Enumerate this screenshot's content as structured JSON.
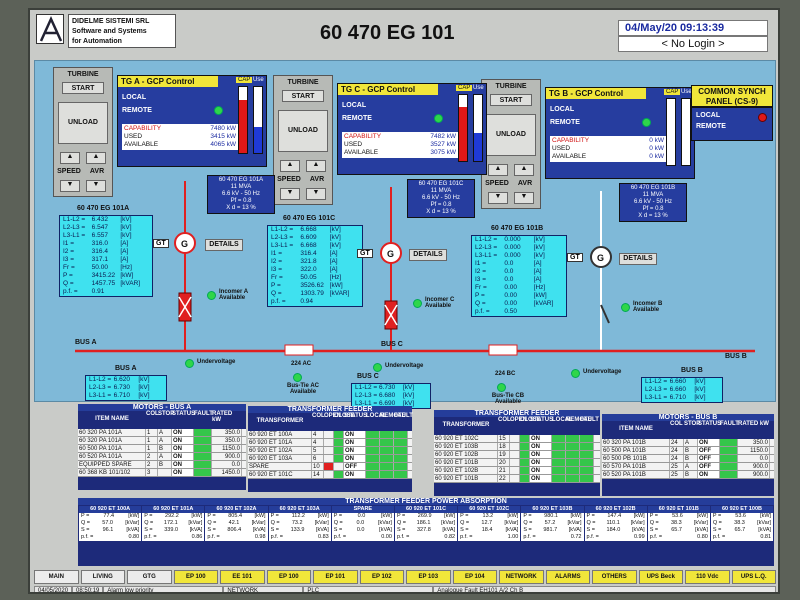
{
  "header": {
    "company_line1": "DIDELME SISTEMI SRL",
    "company_line2": "Software and Systems",
    "company_line3": "for Automation",
    "title": "60 470 EG 101",
    "datetime": "04/May/20 09:13:39",
    "login": "< No Login >"
  },
  "controls": {
    "turbine": "TURBINE",
    "start": "START",
    "unload": "UNLOAD",
    "speed": "SPEED",
    "avr": "AVR"
  },
  "gcp": [
    {
      "title": "TG A - GCP Control",
      "local": "LOCAL",
      "remote": "REMOTE",
      "cap": "CAP",
      "use": "Use",
      "capability_label": "CAPABILITY",
      "capability": "7480 kW",
      "used_label": "USED",
      "used": "3415 kW",
      "available_label": "AVAILABLE",
      "available": "4065 kW",
      "cap_level": 0.8,
      "use_level": 0.4
    },
    {
      "title": "TG C - GCP Control",
      "local": "LOCAL",
      "remote": "REMOTE",
      "cap": "CAP",
      "use": "Use",
      "capability_label": "CAPABILITY",
      "capability": "7482 kW",
      "used_label": "USED",
      "used": "3527 kW",
      "available_label": "AVAILABLE",
      "available": "3075 kW",
      "cap_level": 0.82,
      "use_level": 0.42
    },
    {
      "title": "TG B - GCP Control",
      "local": "LOCAL",
      "remote": "REMOTE",
      "cap": "CAP",
      "use": "Use",
      "capability_label": "CAPABILITY",
      "capability": "0 kW",
      "used_label": "USED",
      "used": "0 kW",
      "available_label": "AVAILABLE",
      "available": "0 kW",
      "cap_level": 0,
      "use_level": 0
    }
  ],
  "sync": {
    "title": "COMMON SYNCH PANEL (CS-9)",
    "local": "LOCAL",
    "remote": "REMOTE"
  },
  "gen_labels": [
    {
      "l1": "60 470 EG 101A",
      "l2": "11 MVA",
      "l3": "6.6 kV - 50 Hz",
      "l4": "Pf = 0.8",
      "l5": "X d = 13 %"
    },
    {
      "l1": "60 470 EG 101C",
      "l2": "11 MVA",
      "l3": "6.6 kV - 50 Hz",
      "l4": "Pf = 0.8",
      "l5": "X d = 13 %"
    },
    {
      "l1": "60 470 EG 101B",
      "l2": "11 MVA",
      "l3": "6.6 kV - 50 Hz",
      "l4": "Pf = 0.8",
      "l5": "X d = 13 %"
    }
  ],
  "meters": [
    {
      "title": "60 470 EG 101A",
      "rows": [
        [
          "L1-L2 =",
          "6.432",
          "[kV]"
        ],
        [
          "L2-L3 =",
          "6.547",
          "[kV]"
        ],
        [
          "L3-L1 =",
          "6.557",
          "[kV]"
        ],
        [
          "I1 =",
          "316.0",
          "[A]"
        ],
        [
          "I2 =",
          "316.4",
          "[A]"
        ],
        [
          "I3 =",
          "317.1",
          "[A]"
        ],
        [
          "Fr =",
          "50.00",
          "[Hz]"
        ],
        [
          "P =",
          "3415.22",
          "[kW]"
        ],
        [
          "Q =",
          "1457.75",
          "[kVAR]"
        ],
        [
          "p.f. =",
          "0.91",
          ""
        ]
      ]
    },
    {
      "title": "60 470 EG 101C",
      "rows": [
        [
          "L1-L2 =",
          "6.668",
          "[kV]"
        ],
        [
          "L2-L3 =",
          "6.609",
          "[kV]"
        ],
        [
          "L3-L1 =",
          "6.668",
          "[kV]"
        ],
        [
          "I1 =",
          "316.4",
          "[A]"
        ],
        [
          "I2 =",
          "321.8",
          "[A]"
        ],
        [
          "I3 =",
          "322.0",
          "[A]"
        ],
        [
          "Fr =",
          "50.05",
          "[Hz]"
        ],
        [
          "P =",
          "3526.62",
          "[kW]"
        ],
        [
          "Q =",
          "1303.79",
          "[kVAR]"
        ],
        [
          "p.f. =",
          "0.94",
          ""
        ]
      ]
    },
    {
      "title": "60 470 EG 101B",
      "rows": [
        [
          "L1-L2 =",
          "0.000",
          "[kV]"
        ],
        [
          "L2-L3 =",
          "0.000",
          "[kV]"
        ],
        [
          "L3-L1 =",
          "0.000",
          "[kV]"
        ],
        [
          "I1 =",
          "0.0",
          "[A]"
        ],
        [
          "I2 =",
          "0.0",
          "[A]"
        ],
        [
          "I3 =",
          "0.0",
          "[A]"
        ],
        [
          "Fr =",
          "0.00",
          "[Hz]"
        ],
        [
          "P =",
          "0.00",
          "[kW]"
        ],
        [
          "Q =",
          "0.00",
          "[kVAR]"
        ],
        [
          "p.f. =",
          "0.50",
          ""
        ]
      ]
    }
  ],
  "gt": "GT",
  "details": "DETAILS",
  "incomers": [
    "Incomer A Available",
    "Incomer C Available",
    "Incomer B Available"
  ],
  "bus": {
    "bus_a": "BUS A",
    "bus_b": "BUS B",
    "bus_c": "BUS C",
    "undervoltage": "Undervoltage",
    "tie_ac_id": "224 AC",
    "tie_ac": "Bus-Tie AC Available",
    "tie_bc_id": "224 BC",
    "tie_bc": "Bus-Tie CB Available",
    "a_vals": [
      [
        "L1-L2 =",
        "6.620",
        "[kV]"
      ],
      [
        "L2-L3 =",
        "6.730",
        "[kV]"
      ],
      [
        "L3-L1 =",
        "6.710",
        "[kV]"
      ]
    ],
    "c_vals": [
      [
        "L1-L2 =",
        "6.730",
        "[kV]"
      ],
      [
        "L2-L3 =",
        "6.680",
        "[kV]"
      ],
      [
        "L3-L1 =",
        "6.690",
        "[kV]"
      ]
    ],
    "b_vals": [
      [
        "L1-L2 =",
        "6.660",
        "[kV]"
      ],
      [
        "L2-L3 =",
        "6.660",
        "[kV]"
      ],
      [
        "L3-L1 =",
        "6.710",
        "[kV]"
      ]
    ]
  },
  "motors_a": {
    "title": "MOTORS - BUS A",
    "headers": [
      "ITEM NAME",
      "COL",
      "STOP",
      "STATUS",
      "FAULT",
      "RATED kW"
    ],
    "rows": [
      [
        "60 320 PA 101A",
        "1",
        "A",
        "ON",
        "350.0"
      ],
      [
        "60 320 PA 101A",
        "1",
        "A",
        "ON",
        "350.0"
      ],
      [
        "60 500 PA 101A",
        "1",
        "B",
        "ON",
        "1150.0"
      ],
      [
        "60 520 PA 101A",
        "2",
        "A",
        "ON",
        "900.0"
      ],
      [
        "EQUIPPED SPARE",
        "2",
        "B",
        "ON",
        "0.0"
      ],
      [
        "60 368 KB 101/102",
        "3",
        "",
        "ON",
        "1450.0"
      ]
    ]
  },
  "tf_a": {
    "title": "TRANSFORMER FEEDER",
    "headers": [
      "TRANSFORMER",
      "COL",
      "OPEN",
      "CLOSE",
      "STATUS",
      "LOCAL",
      "REMOTE",
      "FAULT"
    ],
    "rows": [
      [
        "60 920 ET 100A",
        "4",
        "ON"
      ],
      [
        "60 920 ET 101A",
        "4",
        "ON"
      ],
      [
        "60 920 ET 102A",
        "5",
        "ON"
      ],
      [
        "60 920 ET 103A",
        "6",
        "ON"
      ],
      [
        "SPARE",
        "10",
        "OFF"
      ],
      [
        "60 920 ET 101C",
        "14",
        "ON"
      ]
    ]
  },
  "tf_b": {
    "title": "TRANSFORMER FEEDER",
    "headers": [
      "TRANSFORMER",
      "COL",
      "OPEN",
      "CLOSE",
      "STATUS",
      "LOCAL",
      "REMOTE",
      "FAULT"
    ],
    "rows": [
      [
        "60 920 ET 102C",
        "15",
        "ON"
      ],
      [
        "60 920 ET 103B",
        "18",
        "ON"
      ],
      [
        "60 920 ET 102B",
        "19",
        "ON"
      ],
      [
        "60 920 ET 101B",
        "20",
        "ON"
      ],
      [
        "60 920 ET 102B",
        "21",
        "ON"
      ],
      [
        "60 920 ET 101B",
        "22",
        "ON"
      ]
    ]
  },
  "motors_b": {
    "title": "MOTORS - BUS B",
    "headers": [
      "ITEM NAME",
      "COL",
      "STOP",
      "STATUS",
      "FAULT",
      "RATED kW"
    ],
    "rows": [
      [
        "60 320 PA 101B",
        "24",
        "A",
        "ON",
        "350.0"
      ],
      [
        "60 500 PA 101B",
        "24",
        "B",
        "OFF",
        "1150.0"
      ],
      [
        "60 500 PB 101B",
        "24",
        "B",
        "OFF",
        "0.0"
      ],
      [
        "60 570 PA 101B",
        "25",
        "A",
        "OFF",
        "900.0"
      ],
      [
        "60 520 PA 101B",
        "25",
        "B",
        "ON",
        "900.0"
      ]
    ]
  },
  "absorption": {
    "title": "TRANSFORMER FEEDER POWER ABSORPTION",
    "cols": [
      {
        "name": "60 920 ET 100A",
        "p": "77.4",
        "q": "57.0",
        "s": "96.1",
        "pf": "0.80"
      },
      {
        "name": "60 920 ET 101A",
        "p": "292.2",
        "q": "172.1",
        "s": "339.0",
        "pf": "0.86"
      },
      {
        "name": "60 920 ET 102A",
        "p": "805.4",
        "q": "42.1",
        "s": "806.4",
        "pf": "0.98"
      },
      {
        "name": "60 920 ET 103A",
        "p": "112.2",
        "q": "73.2",
        "s": "133.9",
        "pf": "0.83"
      },
      {
        "name": "SPARE",
        "p": "0.0",
        "q": "0.0",
        "s": "0.0",
        "pf": "0.00"
      },
      {
        "name": "60 920 ET 101C",
        "p": "269.9",
        "q": "186.1",
        "s": "327.8",
        "pf": "0.82"
      },
      {
        "name": "60 920 ET 102C",
        "p": "13.2",
        "q": "12.7",
        "s": "18.4",
        "pf": "1.00"
      },
      {
        "name": "60 920 ET 103B",
        "p": "980.1",
        "q": "57.2",
        "s": "981.7",
        "pf": "0.72"
      },
      {
        "name": "60 920 ET 102B",
        "p": "147.4",
        "q": "110.1",
        "s": "184.0",
        "pf": "0.99"
      },
      {
        "name": "60 920 ET 101B",
        "p": "53.6",
        "q": "38.3",
        "s": "65.7",
        "pf": "0.80"
      },
      {
        "name": "60 920 ET 100B",
        "p": "53.6",
        "q": "38.3",
        "s": "65.7",
        "pf": "0.81"
      }
    ],
    "units": {
      "p": "[kW]",
      "q": "[kVar]",
      "s": "[kVA]"
    }
  },
  "tabs": [
    "MAIN",
    "LIVING",
    "GTG",
    "EP 100",
    "EE 101",
    "EP 100",
    "EP 101",
    "EP 102",
    "EP 103",
    "EP 104",
    "NETWORK",
    "ALARMS",
    "OTHERS",
    "UPS Beck",
    "110 Vdc",
    "UPS L.Q."
  ],
  "status": {
    "date": "04/05/2020",
    "time": "08:50:19",
    "alarm": "Alarm low priority",
    "network": "NETWORK",
    "plc": "PLC",
    "fault": "Analogue Fault EH101 A/2 Ch B"
  },
  "colors": {
    "panel": "#7fb9d8",
    "cyan": "#3fe1ef",
    "gcp": "#263d9f",
    "yellow": "#f1e63a",
    "red_line": "#e02020",
    "green_led": "#2fd64a"
  }
}
